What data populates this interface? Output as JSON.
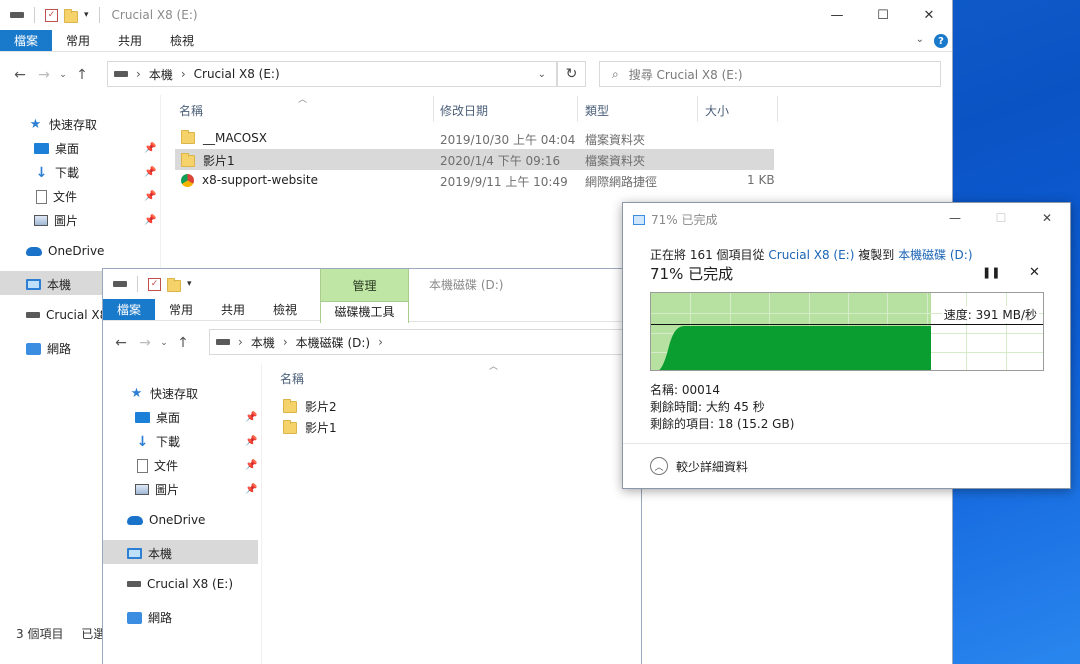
{
  "win1": {
    "title": "Crucial X8 (E:)",
    "ribbon_tabs": [
      "檔案",
      "常用",
      "共用",
      "檢視"
    ],
    "breadcrumb": [
      "本機",
      "Crucial X8 (E:)"
    ],
    "search_placeholder": "搜尋 Crucial X8 (E:)",
    "nav": {
      "quick_access": "快速存取",
      "desktop": "桌面",
      "downloads": "下載",
      "documents": "文件",
      "pictures": "圖片",
      "onedrive": "OneDrive",
      "this_pc": "本機",
      "drive": "Crucial X8",
      "network": "網路"
    },
    "columns": [
      "名稱",
      "修改日期",
      "類型",
      "大小"
    ],
    "files": [
      {
        "name": "__MACOSX",
        "date": "2019/10/30 上午 04:04",
        "type": "檔案資料夾",
        "size": "",
        "icon": "folder-icon"
      },
      {
        "name": "影片1",
        "date": "2020/1/4 下午 09:16",
        "type": "檔案資料夾",
        "size": "",
        "icon": "folder-icon"
      },
      {
        "name": "x8-support-website",
        "date": "2019/9/11 上午 10:49",
        "type": "網際網路捷徑",
        "size": "1 KB",
        "icon": "chrome-icon"
      }
    ],
    "status": [
      "3 個項目",
      "已選"
    ]
  },
  "win2": {
    "title": "本機磁碟 (D:)",
    "ribbon_tabs": [
      "檔案",
      "常用",
      "共用",
      "檢視"
    ],
    "context_tab": {
      "group": "管理",
      "tab": "磁碟機工具"
    },
    "breadcrumb": [
      "本機",
      "本機磁碟 (D:)"
    ],
    "nav": {
      "quick_access": "快速存取",
      "desktop": "桌面",
      "downloads": "下載",
      "documents": "文件",
      "pictures": "圖片",
      "onedrive": "OneDrive",
      "this_pc": "本機",
      "drive": "Crucial X8 (E:)",
      "network": "網路"
    },
    "column_name": "名稱",
    "files": [
      "影片2",
      "影片1"
    ]
  },
  "dialog": {
    "title": "71% 已完成",
    "line_prefix": "正在將 161 個項目從",
    "source": "Crucial X8 (E:)",
    "line_mid": "複製到",
    "dest": "本機磁碟 (D:)",
    "percent_text": "71% 已完成",
    "progress_fraction": 0.71,
    "speed": "速度: 391 MB/秒",
    "name_line": "名稱: 00014",
    "time_line": "剩餘時間: 大約 45 秒",
    "items_line": "剩餘的項目: 18 (15.2 GB)",
    "less_details": "較少詳細資料"
  },
  "colors": {
    "accent": "#1979ca",
    "graph_fill": "#0a9d2f",
    "graph_done": "#b7e1a0",
    "selection": "#d9d9d9"
  }
}
